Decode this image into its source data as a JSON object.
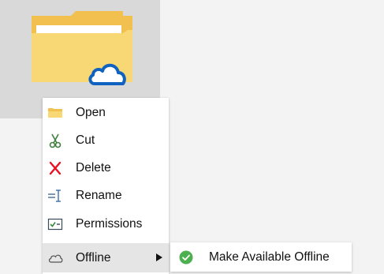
{
  "folder": {
    "icon": "folder-with-cloud-icon"
  },
  "context_menu": {
    "items": [
      {
        "label": "Open",
        "icon": "folder-open-icon"
      },
      {
        "label": "Cut",
        "icon": "scissors-icon"
      },
      {
        "label": "Delete",
        "icon": "delete-x-icon"
      },
      {
        "label": "Rename",
        "icon": "rename-icon"
      },
      {
        "label": "Permissions",
        "icon": "permissions-icon"
      },
      {
        "label": "Offline",
        "icon": "cloud-icon",
        "has_submenu": true,
        "highlighted": true
      }
    ]
  },
  "submenu": {
    "items": [
      {
        "label": "Make Available Offline",
        "icon": "green-check-icon"
      }
    ]
  },
  "colors": {
    "folder_yellow": "#f8d775",
    "folder_dark": "#f1c04f",
    "delete_red": "#e81123",
    "scissors_green": "#3f7f3f",
    "check_green": "#4caf50",
    "cloud_blue": "#0f62c0"
  }
}
